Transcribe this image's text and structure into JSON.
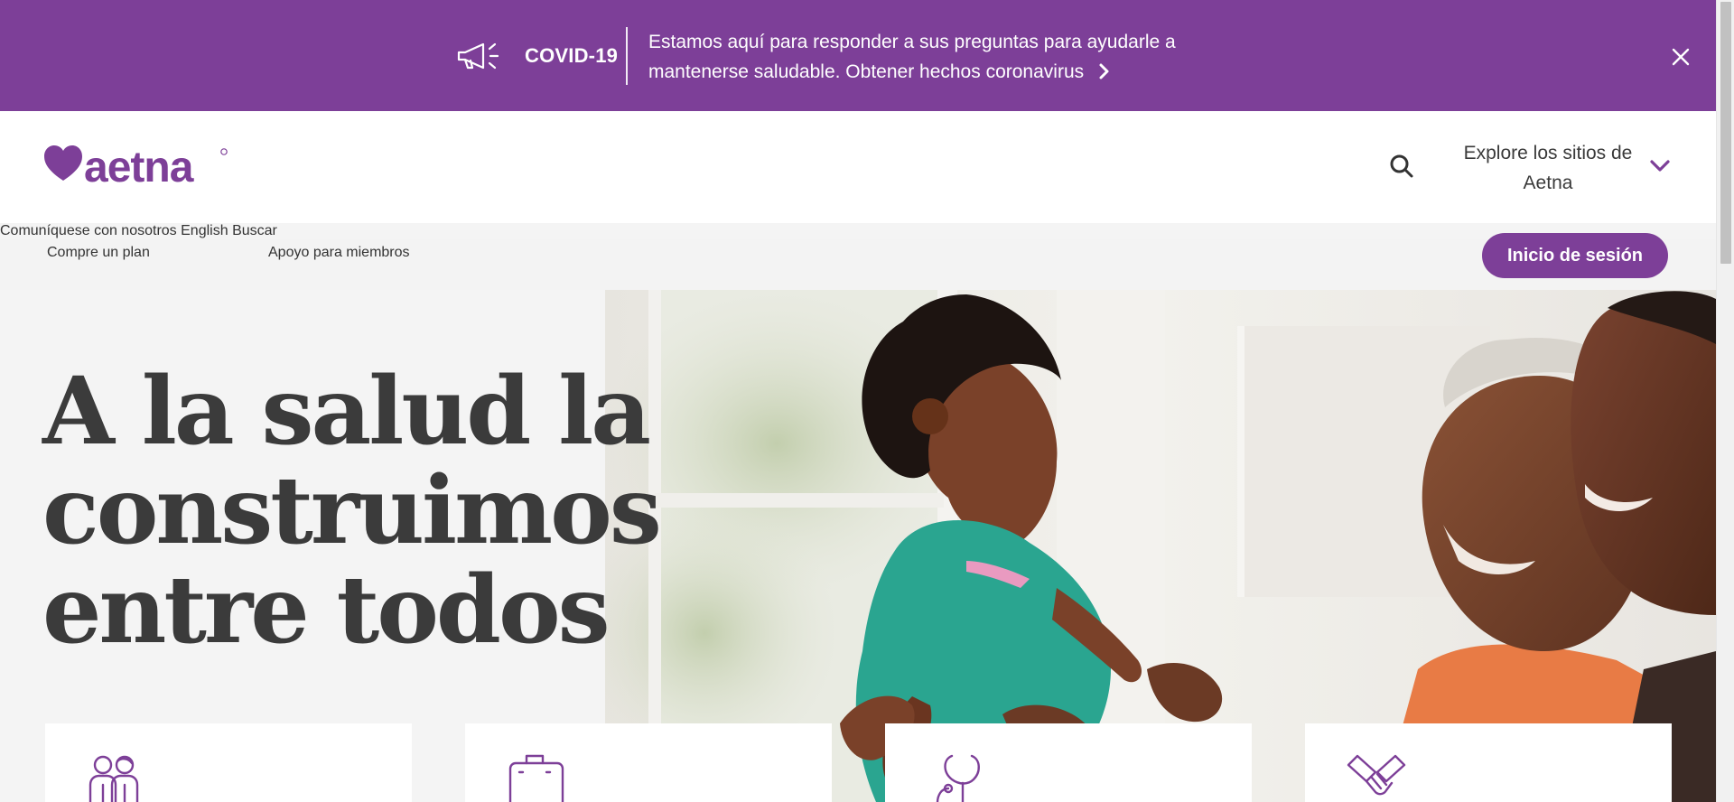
{
  "banner": {
    "tag": "COVID-19",
    "message": "Estamos aquí para responder a sus preguntas para ayudarle a mantenerse saludable. Obtener hechos coronavirus",
    "icon": "megaphone-icon",
    "close_icon": "close-icon",
    "background": "#7d3f98"
  },
  "header": {
    "logo_text": "aetna",
    "contact": "Comuníquese con nosotros",
    "language": "English",
    "search": "Buscar",
    "explore": "Explore los sitios de Aetna"
  },
  "subnav": {
    "shop": "Compre un plan",
    "support": "Apoyo para miembros",
    "signin": "Inicio de sesión"
  },
  "hero": {
    "title": "A la salud la construimos entre todos"
  },
  "cards": [
    {
      "icon": "family-icon"
    },
    {
      "icon": "suitcase-icon"
    },
    {
      "icon": "stethoscope-icon"
    },
    {
      "icon": "handshake-icon"
    }
  ],
  "colors": {
    "accent": "#7d3f98",
    "text": "#3b3b3b"
  }
}
